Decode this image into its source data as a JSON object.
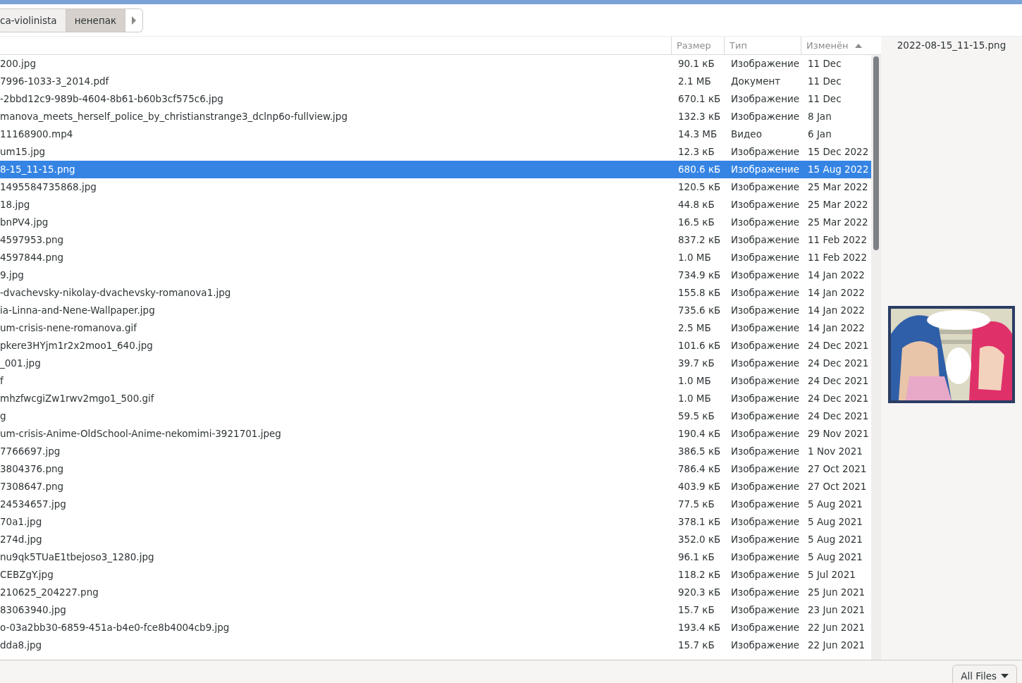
{
  "path_bar": [
    {
      "label": "ca-violinista",
      "selected": false
    },
    {
      "label": "ненепак",
      "selected": true
    }
  ],
  "columns": [
    {
      "label": "Размер"
    },
    {
      "label": "Тип"
    },
    {
      "label": "Изменён",
      "sorted": true
    }
  ],
  "rows": [
    {
      "name": "200.jpg",
      "size": "90.1 кБ",
      "type": "Изображение",
      "modified": "11 Dec",
      "selected": false
    },
    {
      "name": "7996-1033-3_2014.pdf",
      "size": "2.1 МБ",
      "type": "Документ",
      "modified": "11 Dec",
      "selected": false
    },
    {
      "name": "-2bbd12c9-989b-4604-8b61-b60b3cf575c6.jpg",
      "size": "670.1 кБ",
      "type": "Изображение",
      "modified": "11 Dec",
      "selected": false
    },
    {
      "name": "manova_meets_herself_police_by_christianstrange3_dclnp6o-fullview.jpg",
      "size": "132.3 кБ",
      "type": "Изображение",
      "modified": "8 Jan",
      "selected": false
    },
    {
      "name": "11168900.mp4",
      "size": "14.3 МБ",
      "type": "Видео",
      "modified": "6 Jan",
      "selected": false
    },
    {
      "name": "um15.jpg",
      "size": "12.3 кБ",
      "type": "Изображение",
      "modified": "15 Dec 2022",
      "selected": false
    },
    {
      "name": "8-15_11-15.png",
      "size": "680.6 кБ",
      "type": "Изображение",
      "modified": "15 Aug 2022",
      "selected": true
    },
    {
      "name": "1495584735868.jpg",
      "size": "120.5 кБ",
      "type": "Изображение",
      "modified": "25 Mar 2022",
      "selected": false
    },
    {
      "name": "18.jpg",
      "size": "44.8 кБ",
      "type": "Изображение",
      "modified": "25 Mar 2022",
      "selected": false
    },
    {
      "name": "bnPV4.jpg",
      "size": "16.5 кБ",
      "type": "Изображение",
      "modified": "25 Mar 2022",
      "selected": false
    },
    {
      "name": "4597953.png",
      "size": "837.2 кБ",
      "type": "Изображение",
      "modified": "11 Feb 2022",
      "selected": false
    },
    {
      "name": "4597844.png",
      "size": "1.0 МБ",
      "type": "Изображение",
      "modified": "11 Feb 2022",
      "selected": false
    },
    {
      "name": "9.jpg",
      "size": "734.9 кБ",
      "type": "Изображение",
      "modified": "14 Jan 2022",
      "selected": false
    },
    {
      "name": "-dvachevsky-nikolay-dvachevsky-romanova1.jpg",
      "size": "155.8 кБ",
      "type": "Изображение",
      "modified": "14 Jan 2022",
      "selected": false
    },
    {
      "name": "ia-Linna-and-Nene-Wallpaper.jpg",
      "size": "735.6 кБ",
      "type": "Изображение",
      "modified": "14 Jan 2022",
      "selected": false
    },
    {
      "name": "um-crisis-nene-romanova.gif",
      "size": "2.5 МБ",
      "type": "Изображение",
      "modified": "14 Jan 2022",
      "selected": false
    },
    {
      "name": "pkere3HYjm1r2x2moo1_640.jpg",
      "size": "101.6 кБ",
      "type": "Изображение",
      "modified": "24 Dec 2021",
      "selected": false
    },
    {
      "name": "_001.jpg",
      "size": "39.7 кБ",
      "type": "Изображение",
      "modified": "24 Dec 2021",
      "selected": false
    },
    {
      "name": "f",
      "size": "1.0 МБ",
      "type": "Изображение",
      "modified": "24 Dec 2021",
      "selected": false
    },
    {
      "name": "mhzfwcgiZw1rwv2mgo1_500.gif",
      "size": "1.0 МБ",
      "type": "Изображение",
      "modified": "24 Dec 2021",
      "selected": false
    },
    {
      "name": "g",
      "size": "59.5 кБ",
      "type": "Изображение",
      "modified": "24 Dec 2021",
      "selected": false
    },
    {
      "name": "um-crisis-Anime-OldSchool-Anime-nekomimi-3921701.jpeg",
      "size": "190.4 кБ",
      "type": "Изображение",
      "modified": "29 Nov 2021",
      "selected": false
    },
    {
      "name": "7766697.jpg",
      "size": "386.5 кБ",
      "type": "Изображение",
      "modified": "1 Nov 2021",
      "selected": false
    },
    {
      "name": "3804376.png",
      "size": "786.4 кБ",
      "type": "Изображение",
      "modified": "27 Oct 2021",
      "selected": false
    },
    {
      "name": "7308647.png",
      "size": "403.9 кБ",
      "type": "Изображение",
      "modified": "27 Oct 2021",
      "selected": false
    },
    {
      "name": "24534657.jpg",
      "size": "77.5 кБ",
      "type": "Изображение",
      "modified": "5 Aug 2021",
      "selected": false
    },
    {
      "name": "70a1.jpg",
      "size": "378.1 кБ",
      "type": "Изображение",
      "modified": "5 Aug 2021",
      "selected": false
    },
    {
      "name": "274d.jpg",
      "size": "352.0 кБ",
      "type": "Изображение",
      "modified": "5 Aug 2021",
      "selected": false
    },
    {
      "name": "nu9qk5TUaE1tbejoso3_1280.jpg",
      "size": "96.1 кБ",
      "type": "Изображение",
      "modified": "5 Aug 2021",
      "selected": false
    },
    {
      "name": "CEBZgY.jpg",
      "size": "118.2 кБ",
      "type": "Изображение",
      "modified": "5 Jul 2021",
      "selected": false
    },
    {
      "name": "210625_204227.png",
      "size": "920.3 кБ",
      "type": "Изображение",
      "modified": "25 Jun 2021",
      "selected": false
    },
    {
      "name": "83063940.jpg",
      "size": "15.7 кБ",
      "type": "Изображение",
      "modified": "23 Jun 2021",
      "selected": false
    },
    {
      "name": "o-03a2bb30-6859-451a-b4e0-fce8b4004cb9.jpg",
      "size": "193.4 кБ",
      "type": "Изображение",
      "modified": "22 Jun 2021",
      "selected": false
    },
    {
      "name": "dda8.jpg",
      "size": "15.7 кБ",
      "type": "Изображение",
      "modified": "22 Jun 2021",
      "selected": false
    }
  ],
  "preview": {
    "filename": "2022-08-15_11-15.png"
  },
  "filter": {
    "label": "All Files"
  }
}
